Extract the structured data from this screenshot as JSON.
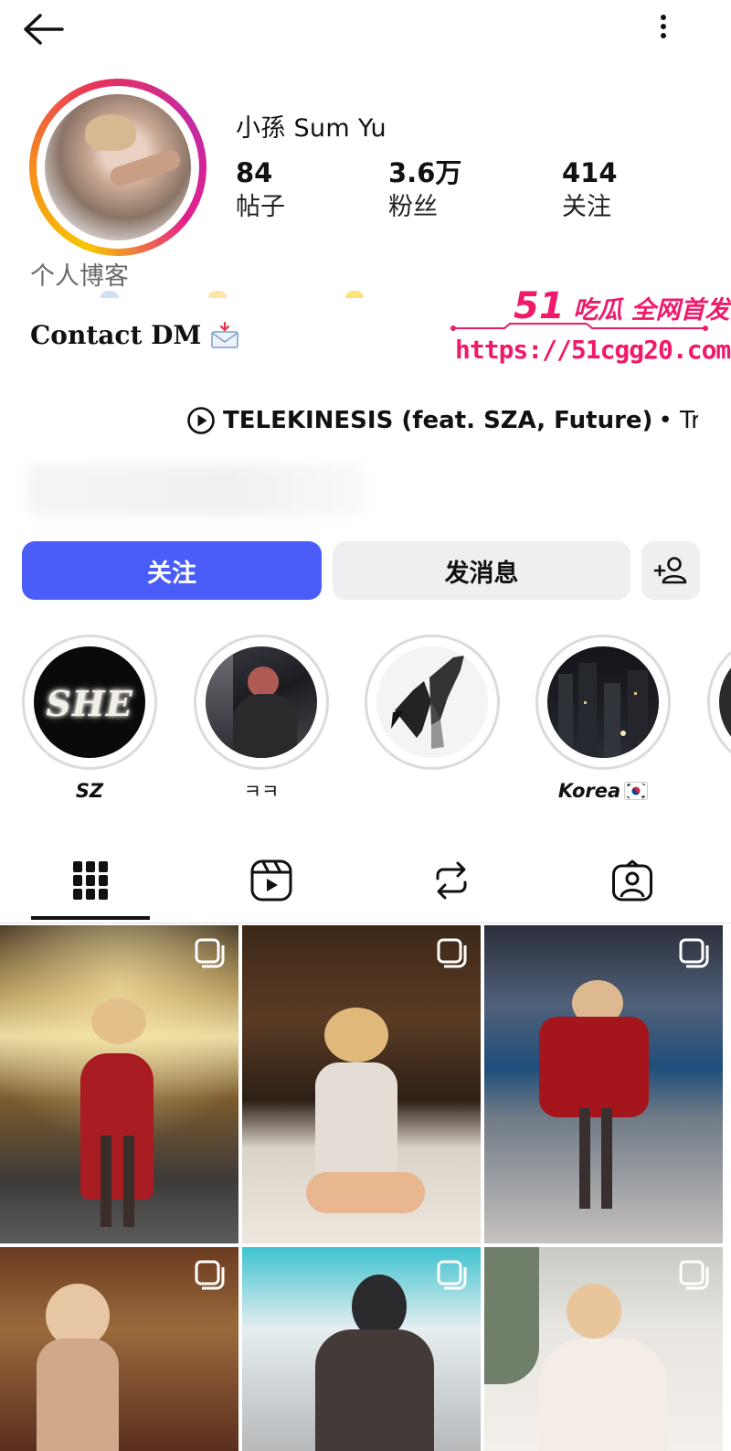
{
  "profile": {
    "name": "小孫 Sum Yu",
    "category": "个人博客",
    "bio_contact": "Contact DM",
    "stats": [
      {
        "value": "84",
        "label": "帖子"
      },
      {
        "value": "3.6万",
        "label": "粉丝"
      },
      {
        "value": "414",
        "label": "关注"
      }
    ]
  },
  "watermark": {
    "number": "51",
    "text": "吃瓜 全网首发",
    "url": "https://51cgg20.com"
  },
  "music": {
    "title": "TELEKINESIS (feat. SZA, Future)",
    "suffix": "• Tr..."
  },
  "actions": {
    "follow_label": "关注",
    "message_label": "发消息"
  },
  "highlights": [
    {
      "caption": "SZ",
      "art_text": "SHE"
    },
    {
      "caption": "ㅋㅋ"
    },
    {
      "caption": ""
    },
    {
      "caption": "Korea"
    }
  ],
  "tabs": [
    "grid-icon",
    "reels-icon",
    "reposts-icon",
    "tagged-icon"
  ],
  "colors": {
    "follow_button": "#4a5df9",
    "secondary_button": "#efeff2",
    "watermark": "#ef1a6a"
  }
}
